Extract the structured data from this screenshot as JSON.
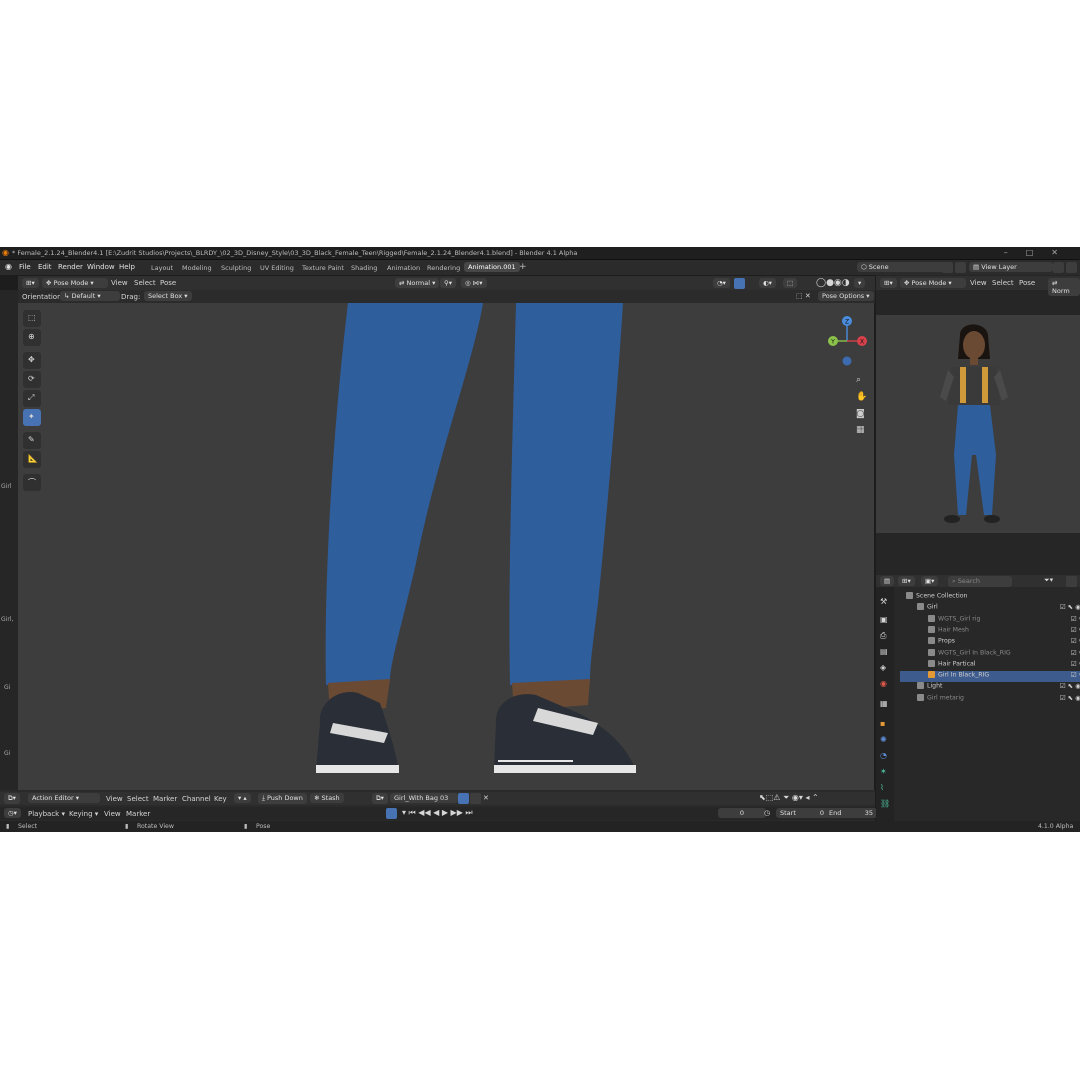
{
  "window": {
    "title": "* Female_2.1.24_Blender4.1 [E:\\Zudrit Studios\\Projects\\_BLRDY_\\02_3D_Disney_Style\\03_3D_Black_Female_Teen\\Rigged\\Female_2.1.24_Blender4.1.blend] - Blender 4.1 Alpha"
  },
  "menu": [
    "File",
    "Edit",
    "Render",
    "Window",
    "Help"
  ],
  "workspaces": [
    "Layout",
    "Modeling",
    "Sculpting",
    "UV Editing",
    "Texture Paint",
    "Shading",
    "Animation",
    "Rendering",
    "Animation.001"
  ],
  "workspace_add": "+",
  "scene": {
    "name": "Scene",
    "view_layer": "View Layer"
  },
  "viewport_header": {
    "mode": "Pose Mode",
    "menus": [
      "View",
      "Select",
      "Pose"
    ],
    "pivot": "Normal",
    "pose_options": "Pose Options"
  },
  "tool_settings": {
    "orientation_label": "Orientation:",
    "orientation_value": "Default",
    "drag_label": "Drag:",
    "drag_value": "Select Box"
  },
  "gizmo": {
    "z": "Z",
    "y": "Y",
    "x": "X"
  },
  "left_edge_labels": [
    "Girl",
    "Girl,",
    "Gi",
    "Gi"
  ],
  "preview_header": {
    "mode": "Pose Mode",
    "menus": [
      "View",
      "Select",
      "Pose"
    ],
    "extra": "Norm"
  },
  "outliner": {
    "search_placeholder": "Search",
    "rows": [
      {
        "label": "Scene Collection",
        "indent": 0,
        "selected": false,
        "dim": false
      },
      {
        "label": "Girl",
        "indent": 1,
        "selected": false,
        "dim": false
      },
      {
        "label": "WGTS_Girl rig",
        "indent": 2,
        "selected": false,
        "dim": true
      },
      {
        "label": "Hair Mesh",
        "indent": 2,
        "selected": false,
        "dim": true
      },
      {
        "label": "Props",
        "indent": 2,
        "selected": false,
        "dim": false
      },
      {
        "label": "WGTS_Girl In Black_RIG",
        "indent": 2,
        "selected": false,
        "dim": true
      },
      {
        "label": "Hair Partical",
        "indent": 2,
        "selected": false,
        "dim": false
      },
      {
        "label": "Girl In Black_RIG",
        "indent": 2,
        "selected": true,
        "dim": false
      },
      {
        "label": "Light",
        "indent": 1,
        "selected": false,
        "dim": false
      },
      {
        "label": "Girl metarig",
        "indent": 1,
        "selected": false,
        "dim": true
      }
    ]
  },
  "action_editor": {
    "mode": "Action Editor",
    "menus": [
      "View",
      "Select",
      "Marker",
      "Channel",
      "Key"
    ],
    "push_down": "Push Down",
    "stash": "Stash",
    "action_name": "Girl_With Bag 03"
  },
  "playback": {
    "menus": [
      "Playback",
      "Keying",
      "View",
      "Marker"
    ],
    "current_frame": "0",
    "start_label": "Start",
    "start": "0",
    "end_label": "End",
    "end": "35"
  },
  "status": {
    "select": "Select",
    "rotate": "Rotate View",
    "pose": "Pose",
    "version": "4.1.0 Alpha"
  },
  "colors": {
    "accent": "#4772b3",
    "viewport": "#3d3d3d",
    "jeans": "#2f5e9c",
    "shoe": "#2a2e36"
  }
}
